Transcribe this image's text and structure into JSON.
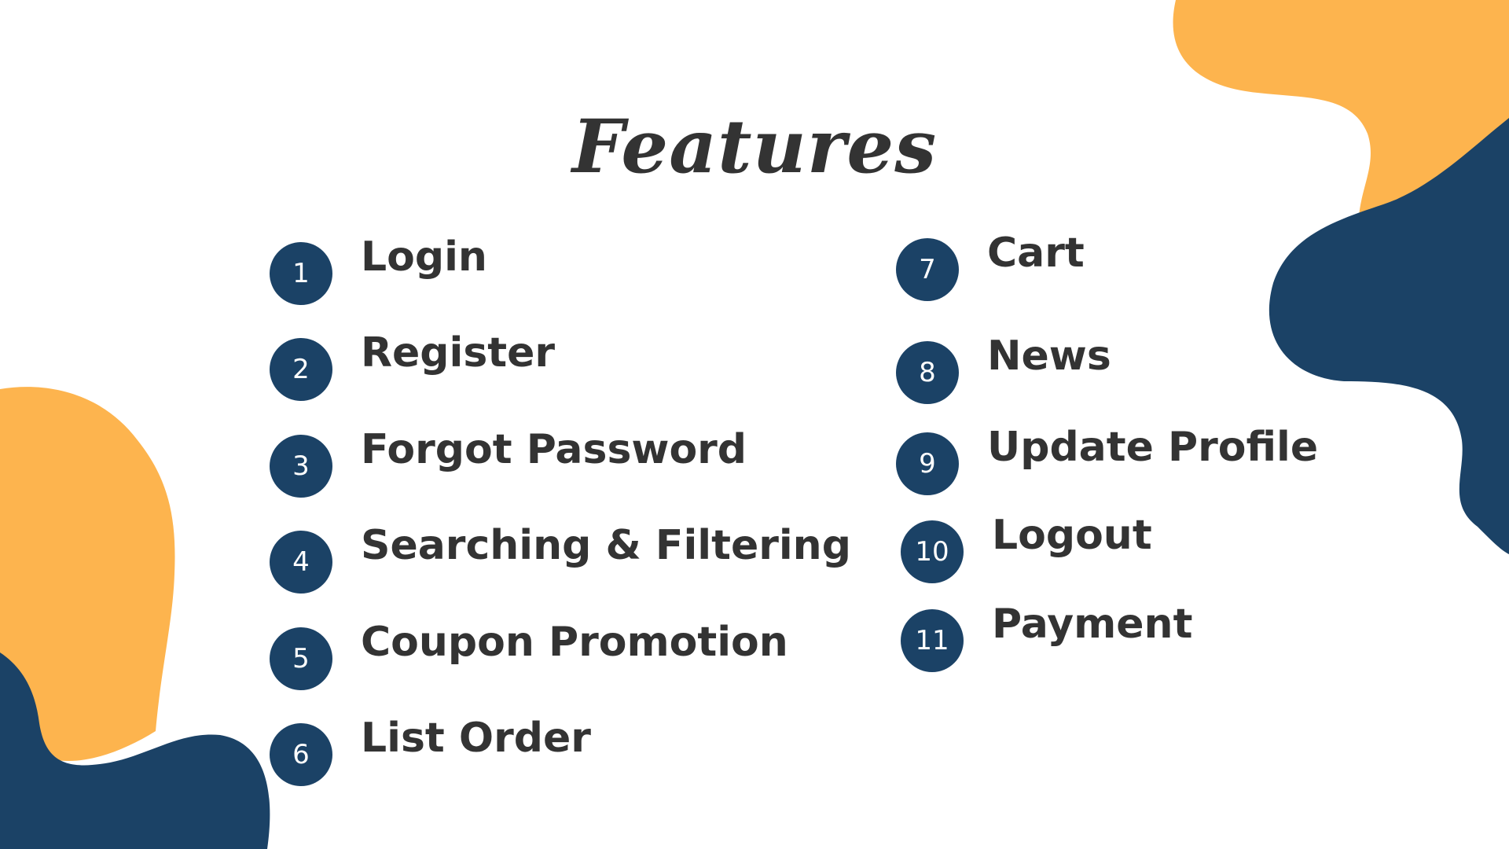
{
  "title": "Features",
  "colors": {
    "badge": "#1b4266",
    "text": "#333333",
    "blob_navy": "#1b4266",
    "blob_orange": "#fdb44e",
    "background": "#ffffff"
  },
  "features": [
    {
      "number": "1",
      "label": "Login"
    },
    {
      "number": "2",
      "label": "Register"
    },
    {
      "number": "3",
      "label": "Forgot Password"
    },
    {
      "number": "4",
      "label": "Searching & Filtering"
    },
    {
      "number": "5",
      "label": "Coupon Promotion"
    },
    {
      "number": "6",
      "label": "List Order"
    },
    {
      "number": "7",
      "label": "Cart"
    },
    {
      "number": "8",
      "label": "News"
    },
    {
      "number": "9",
      "label": "Update Profile"
    },
    {
      "number": "10",
      "label": "Logout"
    },
    {
      "number": "11",
      "label": "Payment"
    }
  ]
}
